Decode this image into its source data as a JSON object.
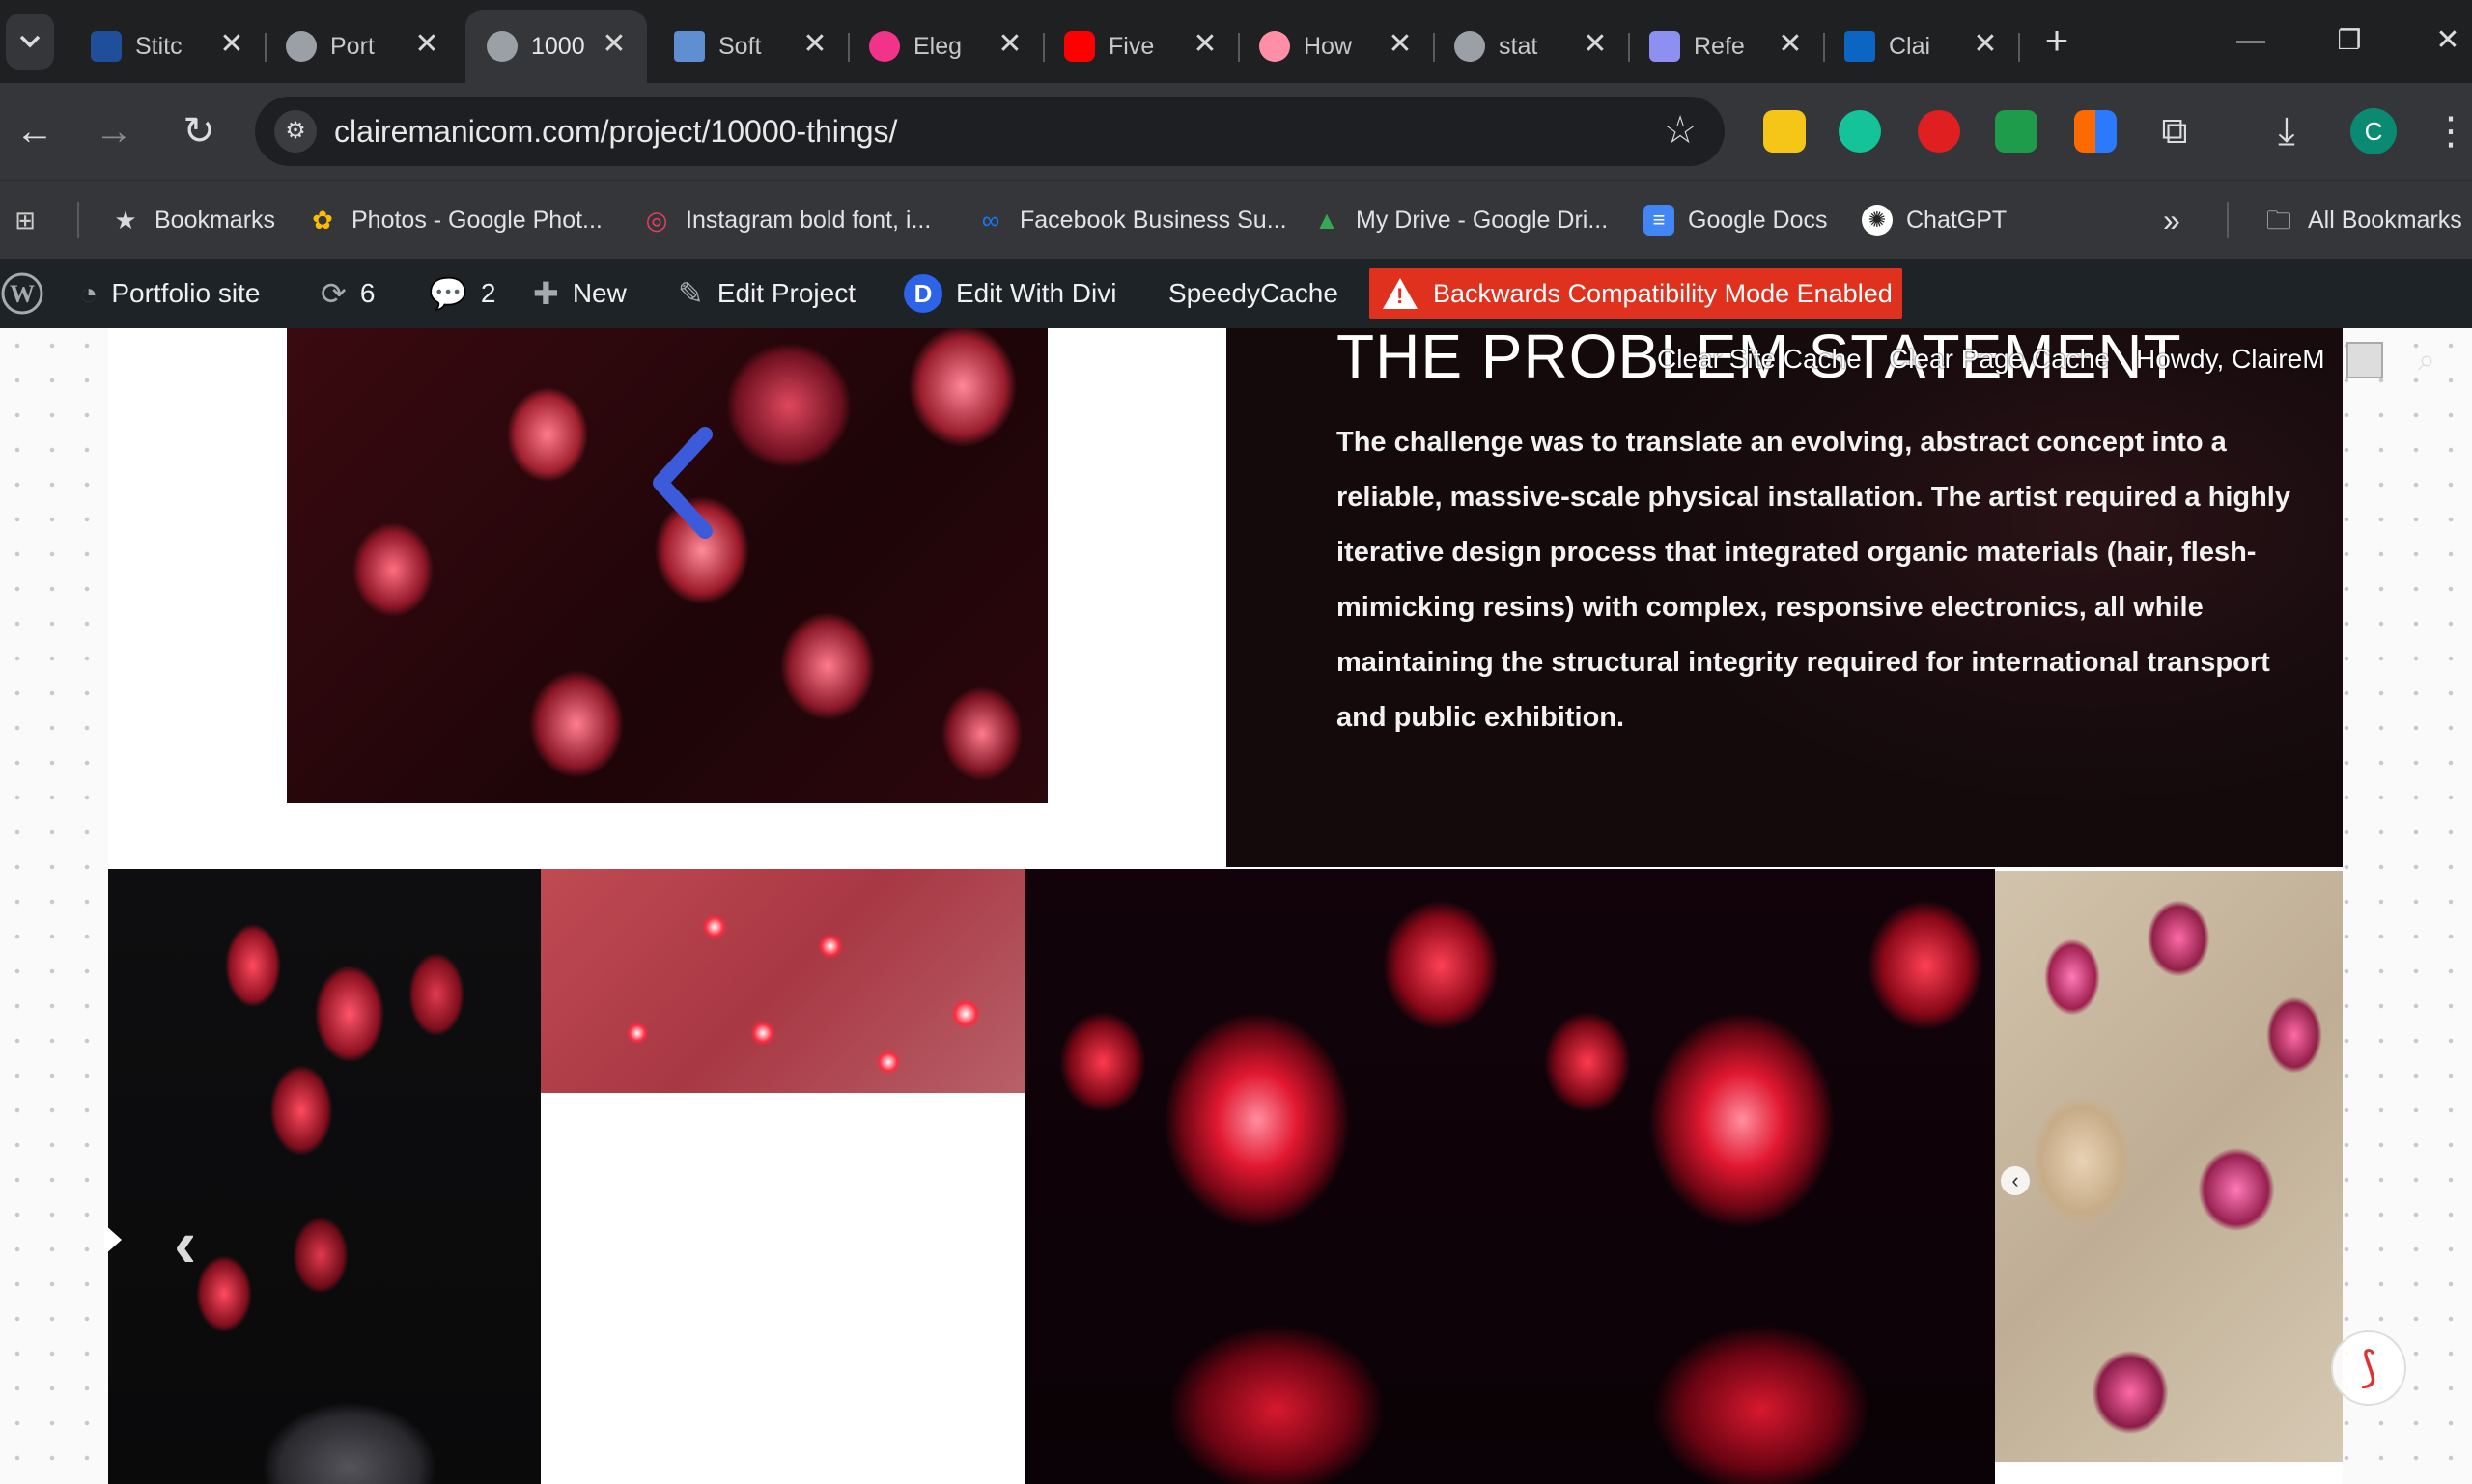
{
  "tabs": [
    {
      "title": "Stitc",
      "color": "#1f4f9a"
    },
    {
      "title": "Port",
      "color": "#9aa0a6"
    },
    {
      "title": "1000",
      "color": "#9aa0a6",
      "active": true
    },
    {
      "title": "Soft",
      "color": "#5f8fd0"
    },
    {
      "title": "Eleg",
      "color": "#f2338a"
    },
    {
      "title": "Five",
      "color": "#ff0000"
    },
    {
      "title": "How",
      "color": "#ff8fa6"
    },
    {
      "title": "stat",
      "color": "#9aa0a6"
    },
    {
      "title": "Refe",
      "color": "#8d90f0"
    },
    {
      "title": "Clai",
      "color": "#0a66c2"
    }
  ],
  "address": {
    "url": "clairemanicom.com/project/10000-things/",
    "avatar_letter": "C"
  },
  "bookmarks": [
    {
      "label": "Bookmarks",
      "icon": "★",
      "color": "#d8d8d8"
    },
    {
      "label": "Photos - Google Phot...",
      "icon": "✿",
      "color": "#fbbc05"
    },
    {
      "label": "Instagram bold font, i...",
      "icon": "◎",
      "color": "#e4405f"
    },
    {
      "label": "Facebook Business Su...",
      "icon": "∞",
      "color": "#1877f2"
    },
    {
      "label": "My Drive - Google Dri...",
      "icon": "▲",
      "color": "#34a853"
    },
    {
      "label": "Google Docs",
      "icon": "≡",
      "color": "#4285f4"
    },
    {
      "label": "ChatGPT",
      "icon": "✺",
      "color": "#ffffff"
    }
  ],
  "all_bookmarks": "All Bookmarks",
  "wpbar": {
    "site": "Portfolio site",
    "updates": "6",
    "comments": "2",
    "new": "New",
    "edit_project": "Edit Project",
    "edit_divi": "Edit With Divi",
    "speedycache": "SpeedyCache",
    "warning": "Backwards Compatibility Mode Enabled"
  },
  "overlay": {
    "clear_site_cache": "Clear Site Cache",
    "clear_page_cache": "Clear Page Cache",
    "howdy": "Howdy, ClaireM"
  },
  "content": {
    "title": "THE PROBLEM STATEMENT",
    "body_bold": "The challenge was to translate an evolving, abstract concept into a reliable, massive-scale physical installation.",
    "body_rest": " The artist required a highly iterative design process that integrated organic materials (hair, flesh-mimicking resins) with complex, responsive electronics, all while maintaining the structural integrity required for international transport and public exhibition."
  },
  "colors": {
    "accent_blue": "#3b5bdb",
    "warning_red": "#e0301e",
    "divi_blue": "#2c63e8"
  }
}
